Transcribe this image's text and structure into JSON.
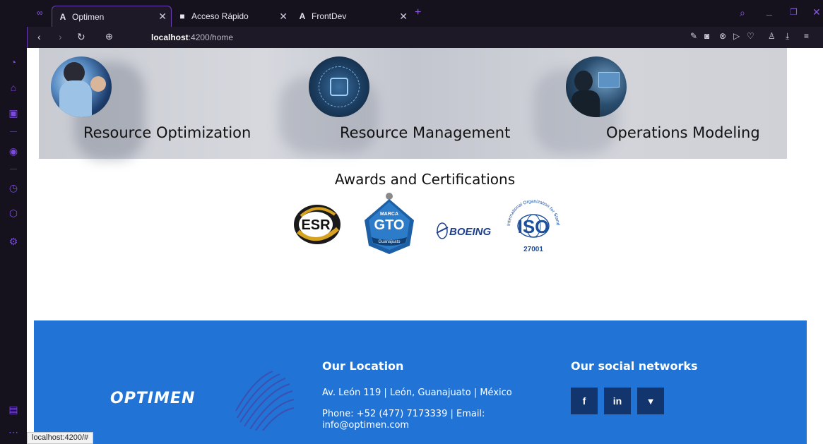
{
  "browser": {
    "tabs": [
      {
        "icon": "A",
        "label": "Optimen",
        "active": true
      },
      {
        "icon": "■",
        "label": "Acceso Rápido",
        "active": false
      },
      {
        "icon": "A",
        "label": "FrontDev",
        "active": false
      }
    ],
    "new_tab_symbol": "+",
    "url_host": "localhost",
    "url_path": ":4200/home",
    "window_controls": [
      "search-icon",
      "minimize-icon",
      "restore-icon",
      "close-icon"
    ]
  },
  "services": [
    {
      "title": "Resource Optimization"
    },
    {
      "title": "Resource Management"
    },
    {
      "title": "Operations Modeling"
    }
  ],
  "awards": {
    "title": "Awards and Certifications",
    "logos": [
      {
        "name": "ESR",
        "text": "ESR"
      },
      {
        "name": "Marca GTO",
        "top": "MARCA",
        "text": "GTO",
        "bottom": "Guanajuato"
      },
      {
        "name": "Boeing",
        "text": "BOEING"
      },
      {
        "name": "ISO",
        "text": "ISO",
        "arc": "International Organization for Standardization",
        "number": "27001"
      }
    ]
  },
  "footer": {
    "brand": "OPTIMEN",
    "location_title": "Our Location",
    "address": "Av. León 119 | León, Guanajuato | México",
    "contact_line1": "Phone: +52 (477) 7173339 | Email:",
    "contact_line2": "info@optimen.com",
    "social_title": "Our social networks",
    "social": [
      {
        "label": "f",
        "name": "facebook"
      },
      {
        "label": "in",
        "name": "linkedin"
      },
      {
        "label": "🐦",
        "name": "twitter"
      }
    ]
  },
  "status_url": "localhost:4200/#",
  "colors": {
    "accent": "#6a3fb6",
    "footer_bg": "#2173d6",
    "social_bg": "#13356e"
  }
}
